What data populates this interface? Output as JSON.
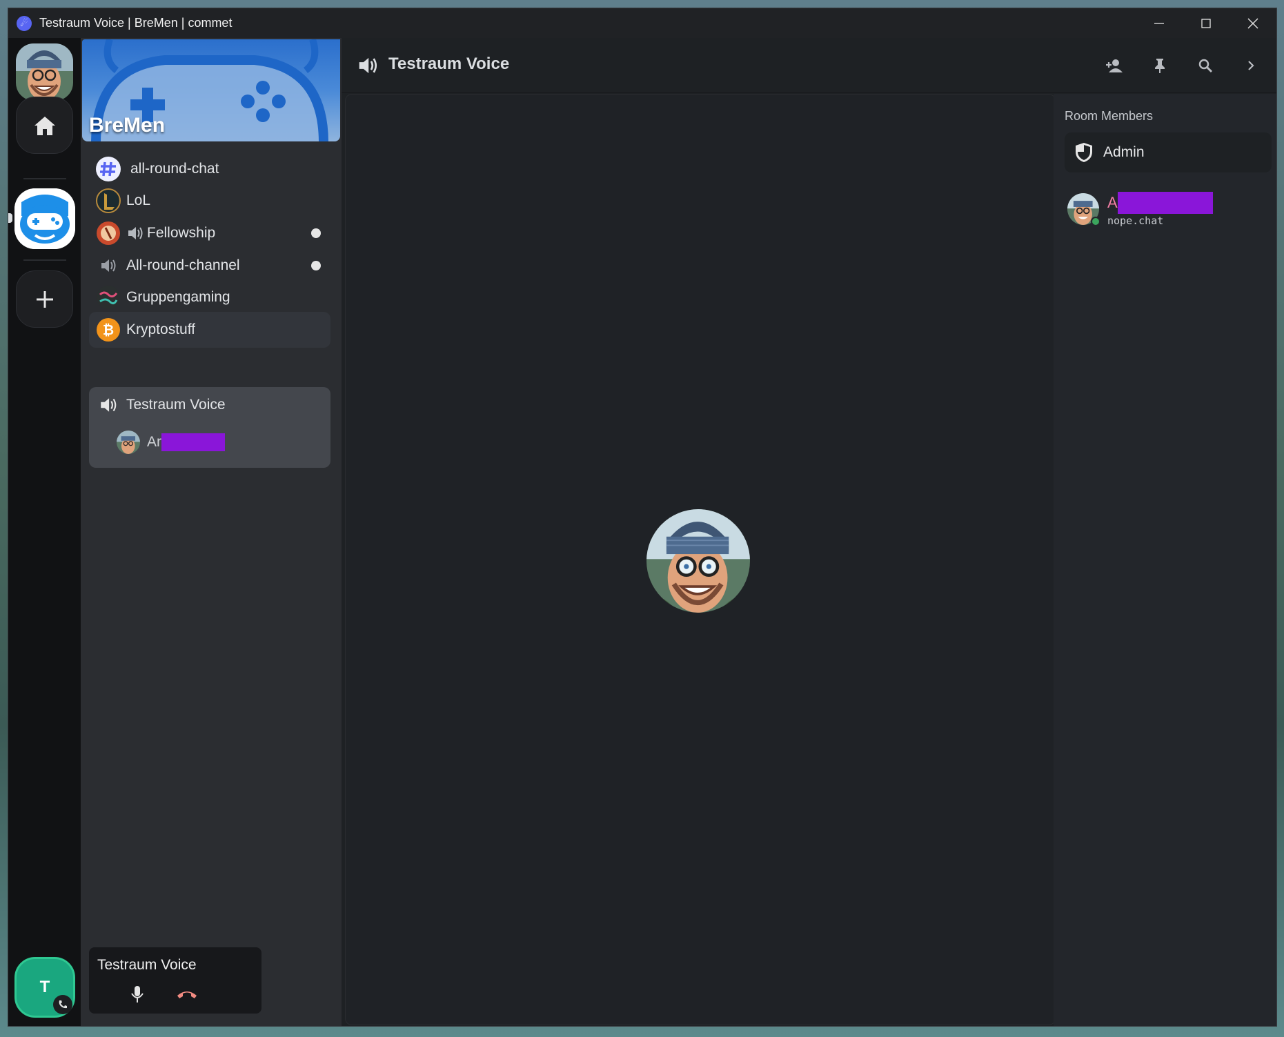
{
  "window": {
    "title": "Testraum Voice | BreMen | commet"
  },
  "rail": {
    "home_icon": "home-icon",
    "add_icon": "plus-icon",
    "user_initial": "T"
  },
  "server": {
    "name": "BreMen"
  },
  "channels": [
    {
      "label": "all-round-chat",
      "icon": "hash-icon"
    },
    {
      "label": "LoL",
      "icon": "league-icon"
    },
    {
      "label": "Fellowship",
      "icon": "speaker-icon"
    },
    {
      "label": "All-round-channel",
      "icon": "speaker-icon"
    },
    {
      "label": "Gruppengaming",
      "icon": "graffiti-icon"
    },
    {
      "label": "Kryptostuff",
      "icon": "bitcoin-icon"
    },
    {
      "label": "Testraum Voice",
      "icon": "speaker-icon"
    }
  ],
  "voice_member": {
    "name": "Ar"
  },
  "voice_panel": {
    "title": "Testraum Voice"
  },
  "header": {
    "title": "Testraum Voice"
  },
  "members": {
    "title": "Room Members",
    "role": "Admin",
    "member_name": "A",
    "member_server": "nope.chat"
  },
  "colors": {
    "accent": "#5865f2",
    "online": "#3ba55d",
    "redaction": "#8a16d9",
    "user_tile": "#1aa77f",
    "member_name": "#f47fa6",
    "hangup": "#f28b82"
  }
}
